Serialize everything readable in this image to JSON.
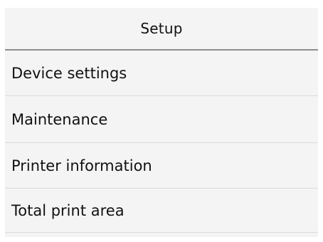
{
  "header": {
    "title": "Setup"
  },
  "menu": {
    "items": [
      {
        "label": "Device settings"
      },
      {
        "label": "Maintenance"
      },
      {
        "label": "Printer information"
      },
      {
        "label": "Total print area"
      }
    ]
  }
}
